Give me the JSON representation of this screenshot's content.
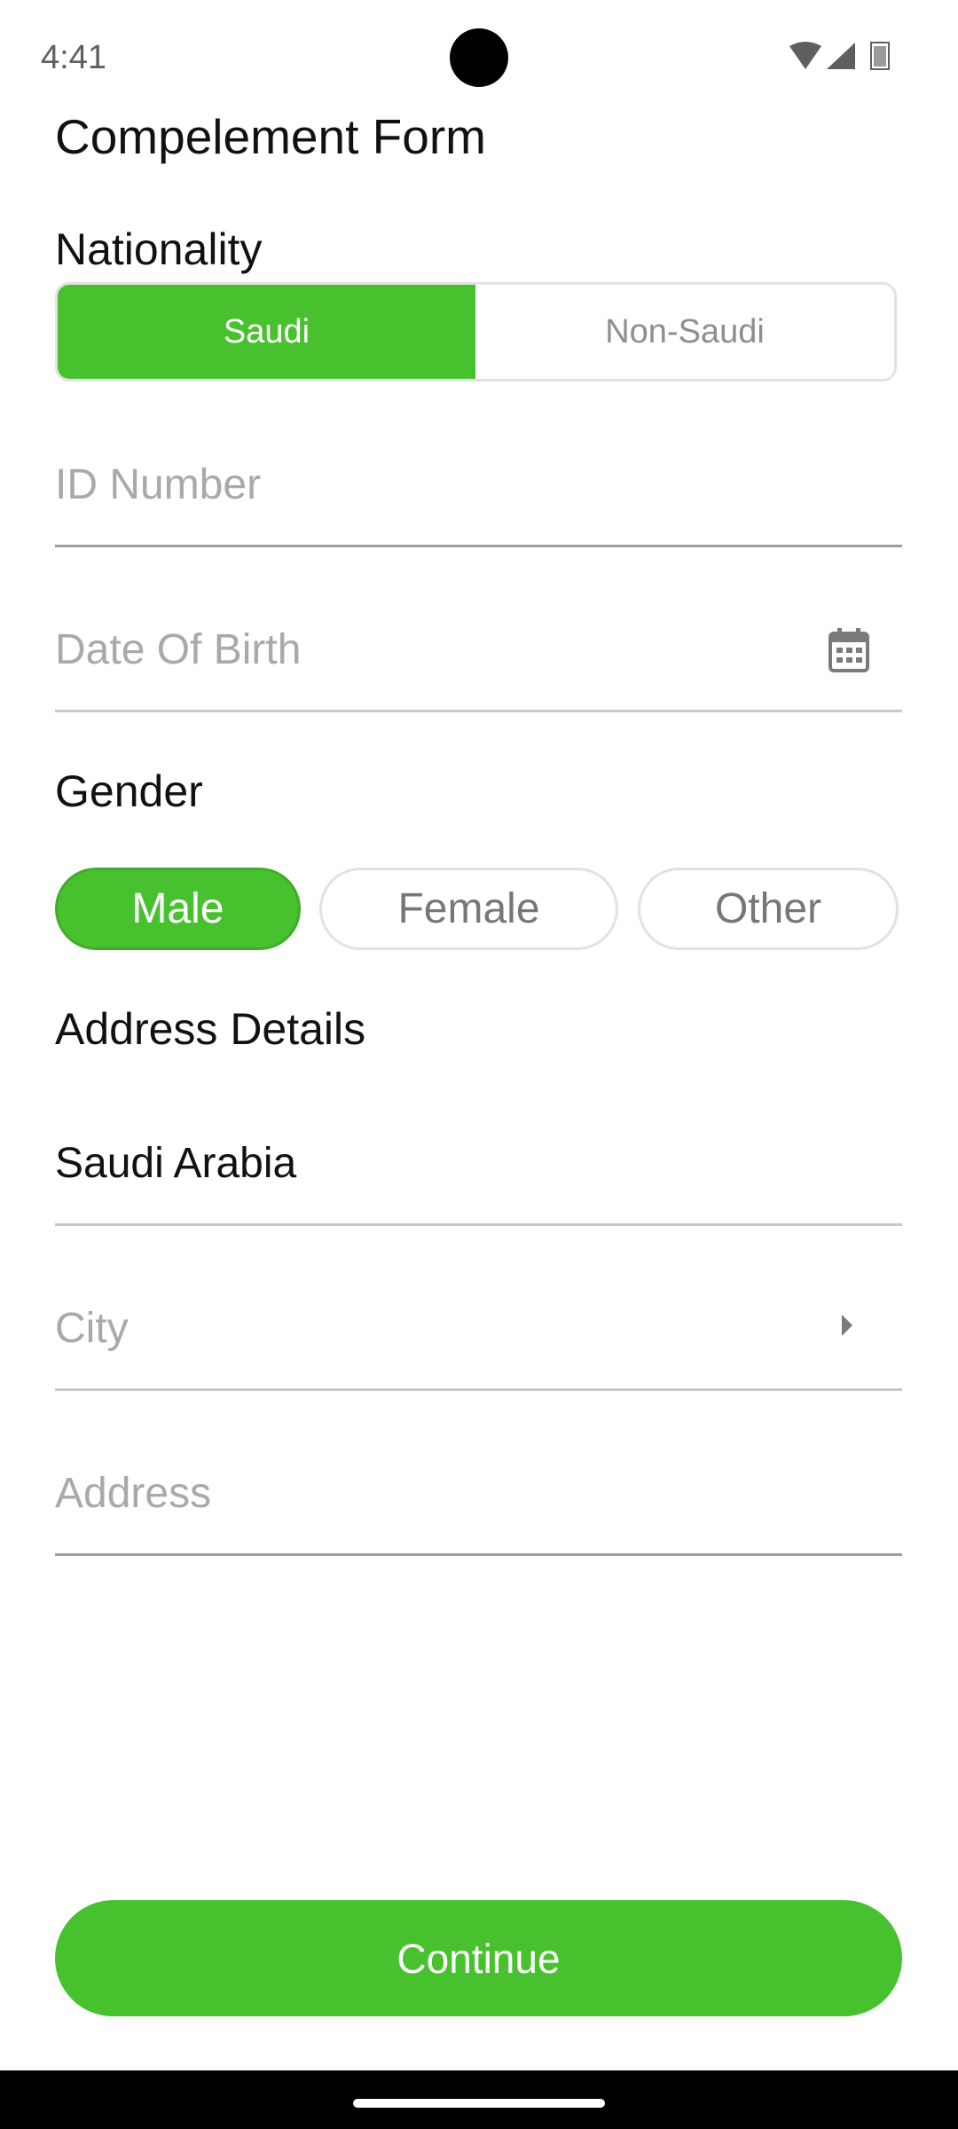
{
  "status_bar": {
    "time": "4:41"
  },
  "page": {
    "title": "Compelement Form"
  },
  "nationality": {
    "label": "Nationality",
    "options": [
      "Saudi",
      "Non-Saudi"
    ],
    "selected": "Saudi"
  },
  "fields": {
    "id_number_placeholder": "ID Number",
    "dob_placeholder": "Date Of Birth",
    "country_value": "Saudi Arabia",
    "city_placeholder": "City",
    "address_placeholder": "Address"
  },
  "gender": {
    "label": "Gender",
    "options": [
      "Male",
      "Female",
      "Other"
    ],
    "selected": "Male"
  },
  "address": {
    "label": "Address Details"
  },
  "actions": {
    "continue_label": "Continue"
  },
  "colors": {
    "accent": "#48c12f",
    "placeholder": "#a9a9a9"
  },
  "icons": {
    "dob": "calendar-icon",
    "city": "chevron-right-icon",
    "status": [
      "wifi-icon",
      "cell-signal-icon",
      "battery-icon"
    ]
  }
}
